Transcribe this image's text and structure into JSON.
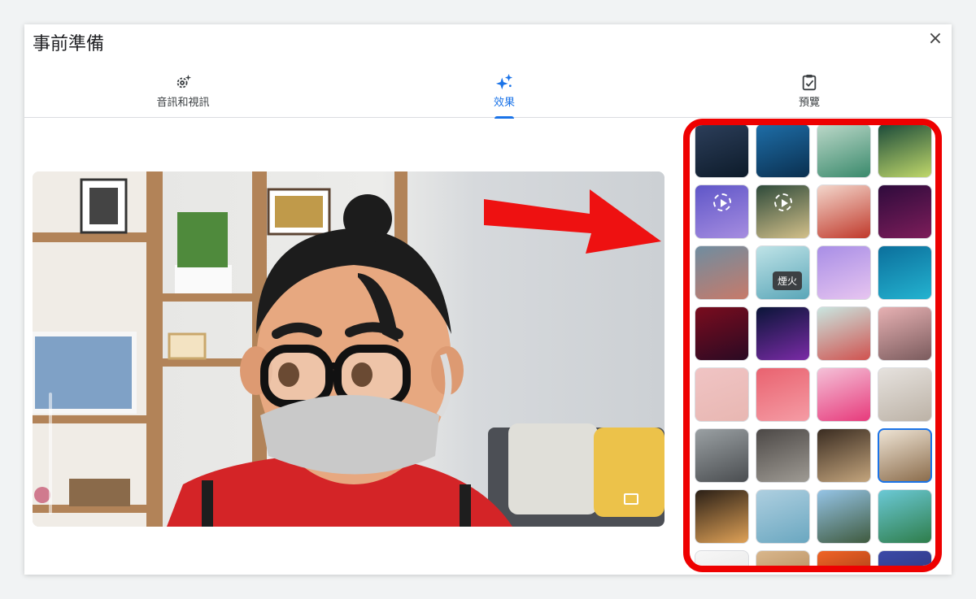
{
  "dialog": {
    "title": "事前準備",
    "close_icon": "×"
  },
  "tabs": [
    {
      "label": "音訊和視訊",
      "icon": "settings-sparkle-icon"
    },
    {
      "label": "效果",
      "icon": "sparkle-icon",
      "active": true
    },
    {
      "label": "預覽",
      "icon": "clipboard-check-icon"
    }
  ],
  "effects": {
    "tooltip": "煙火",
    "tiles": [
      {
        "name": "bg-cinema",
        "colors": [
          "#2c3e5a",
          "#0d1b2a"
        ]
      },
      {
        "name": "bg-blue-night",
        "colors": [
          "#1e6ea8",
          "#0a2f4f"
        ]
      },
      {
        "name": "bg-beach-rocks",
        "colors": [
          "#bcd8c9",
          "#3a8a6c"
        ]
      },
      {
        "name": "bg-forest-glow",
        "colors": [
          "#1b4a3a",
          "#c0d86a"
        ]
      },
      {
        "name": "bg-purple-room",
        "colors": [
          "#5f56c8",
          "#a68de0"
        ],
        "video": true
      },
      {
        "name": "bg-magic-forest",
        "colors": [
          "#2e4a3a",
          "#d3c08a"
        ],
        "video": true
      },
      {
        "name": "bg-red-dragon",
        "colors": [
          "#f3d7cc",
          "#c0392b"
        ]
      },
      {
        "name": "bg-purple-stage",
        "colors": [
          "#2e0b3c",
          "#7d1d5a"
        ]
      },
      {
        "name": "bg-dusk",
        "colors": [
          "#6f8da0",
          "#c77a6a"
        ]
      },
      {
        "name": "bg-sky",
        "colors": [
          "#bfe3e7",
          "#5aa6b8"
        ]
      },
      {
        "name": "bg-clouds",
        "colors": [
          "#a88ee6",
          "#e7c5f0"
        ]
      },
      {
        "name": "bg-water",
        "colors": [
          "#0b6f9c",
          "#24b3d0"
        ]
      },
      {
        "name": "bg-galaxy",
        "colors": [
          "#7a0c1e",
          "#2a0a23"
        ]
      },
      {
        "name": "bg-fireworks",
        "colors": [
          "#0a1538",
          "#7a2ba6"
        ]
      },
      {
        "name": "bg-flower-field",
        "colors": [
          "#c9e6e0",
          "#d0524f"
        ]
      },
      {
        "name": "bg-pink-flowers",
        "colors": [
          "#e7b1b3",
          "#7a5b5d"
        ]
      },
      {
        "name": "bg-confetti",
        "colors": [
          "#f0c4c4",
          "#e8b7b2"
        ]
      },
      {
        "name": "bg-pink-pattern",
        "colors": [
          "#e9626f",
          "#f59ca5"
        ]
      },
      {
        "name": "bg-petals",
        "colors": [
          "#f4c1d8",
          "#e73a7b"
        ]
      },
      {
        "name": "bg-gallery-wall",
        "colors": [
          "#e6e2de",
          "#bcb2a6"
        ]
      },
      {
        "name": "bg-glass-room",
        "colors": [
          "#9aa0a3",
          "#4a4d50"
        ]
      },
      {
        "name": "bg-loft",
        "colors": [
          "#4c4846",
          "#9f9b94"
        ]
      },
      {
        "name": "bg-library",
        "colors": [
          "#3a2c21",
          "#c4a57d"
        ]
      },
      {
        "name": "bg-shelf-room",
        "colors": [
          "#efe5d6",
          "#8a6b4a"
        ],
        "selected": true
      },
      {
        "name": "bg-night-hall",
        "colors": [
          "#2a1f16",
          "#e0a257"
        ]
      },
      {
        "name": "bg-sea-arch",
        "colors": [
          "#aecfe0",
          "#6aa7c0"
        ]
      },
      {
        "name": "bg-mountains",
        "colors": [
          "#95c4e6",
          "#3f5a3e"
        ]
      },
      {
        "name": "bg-tropical-beach",
        "colors": [
          "#6bc9d6",
          "#2e7d4a"
        ]
      },
      {
        "name": "bg-white-room",
        "colors": [
          "#f7f7f7",
          "#e1e1e1"
        ]
      },
      {
        "name": "bg-wood",
        "colors": [
          "#d9b78c",
          "#a77b4d"
        ]
      },
      {
        "name": "bg-autumn",
        "colors": [
          "#f06426",
          "#8a2d12"
        ]
      },
      {
        "name": "bg-fern",
        "colors": [
          "#3b4aa8",
          "#2a2f6c"
        ]
      }
    ]
  }
}
